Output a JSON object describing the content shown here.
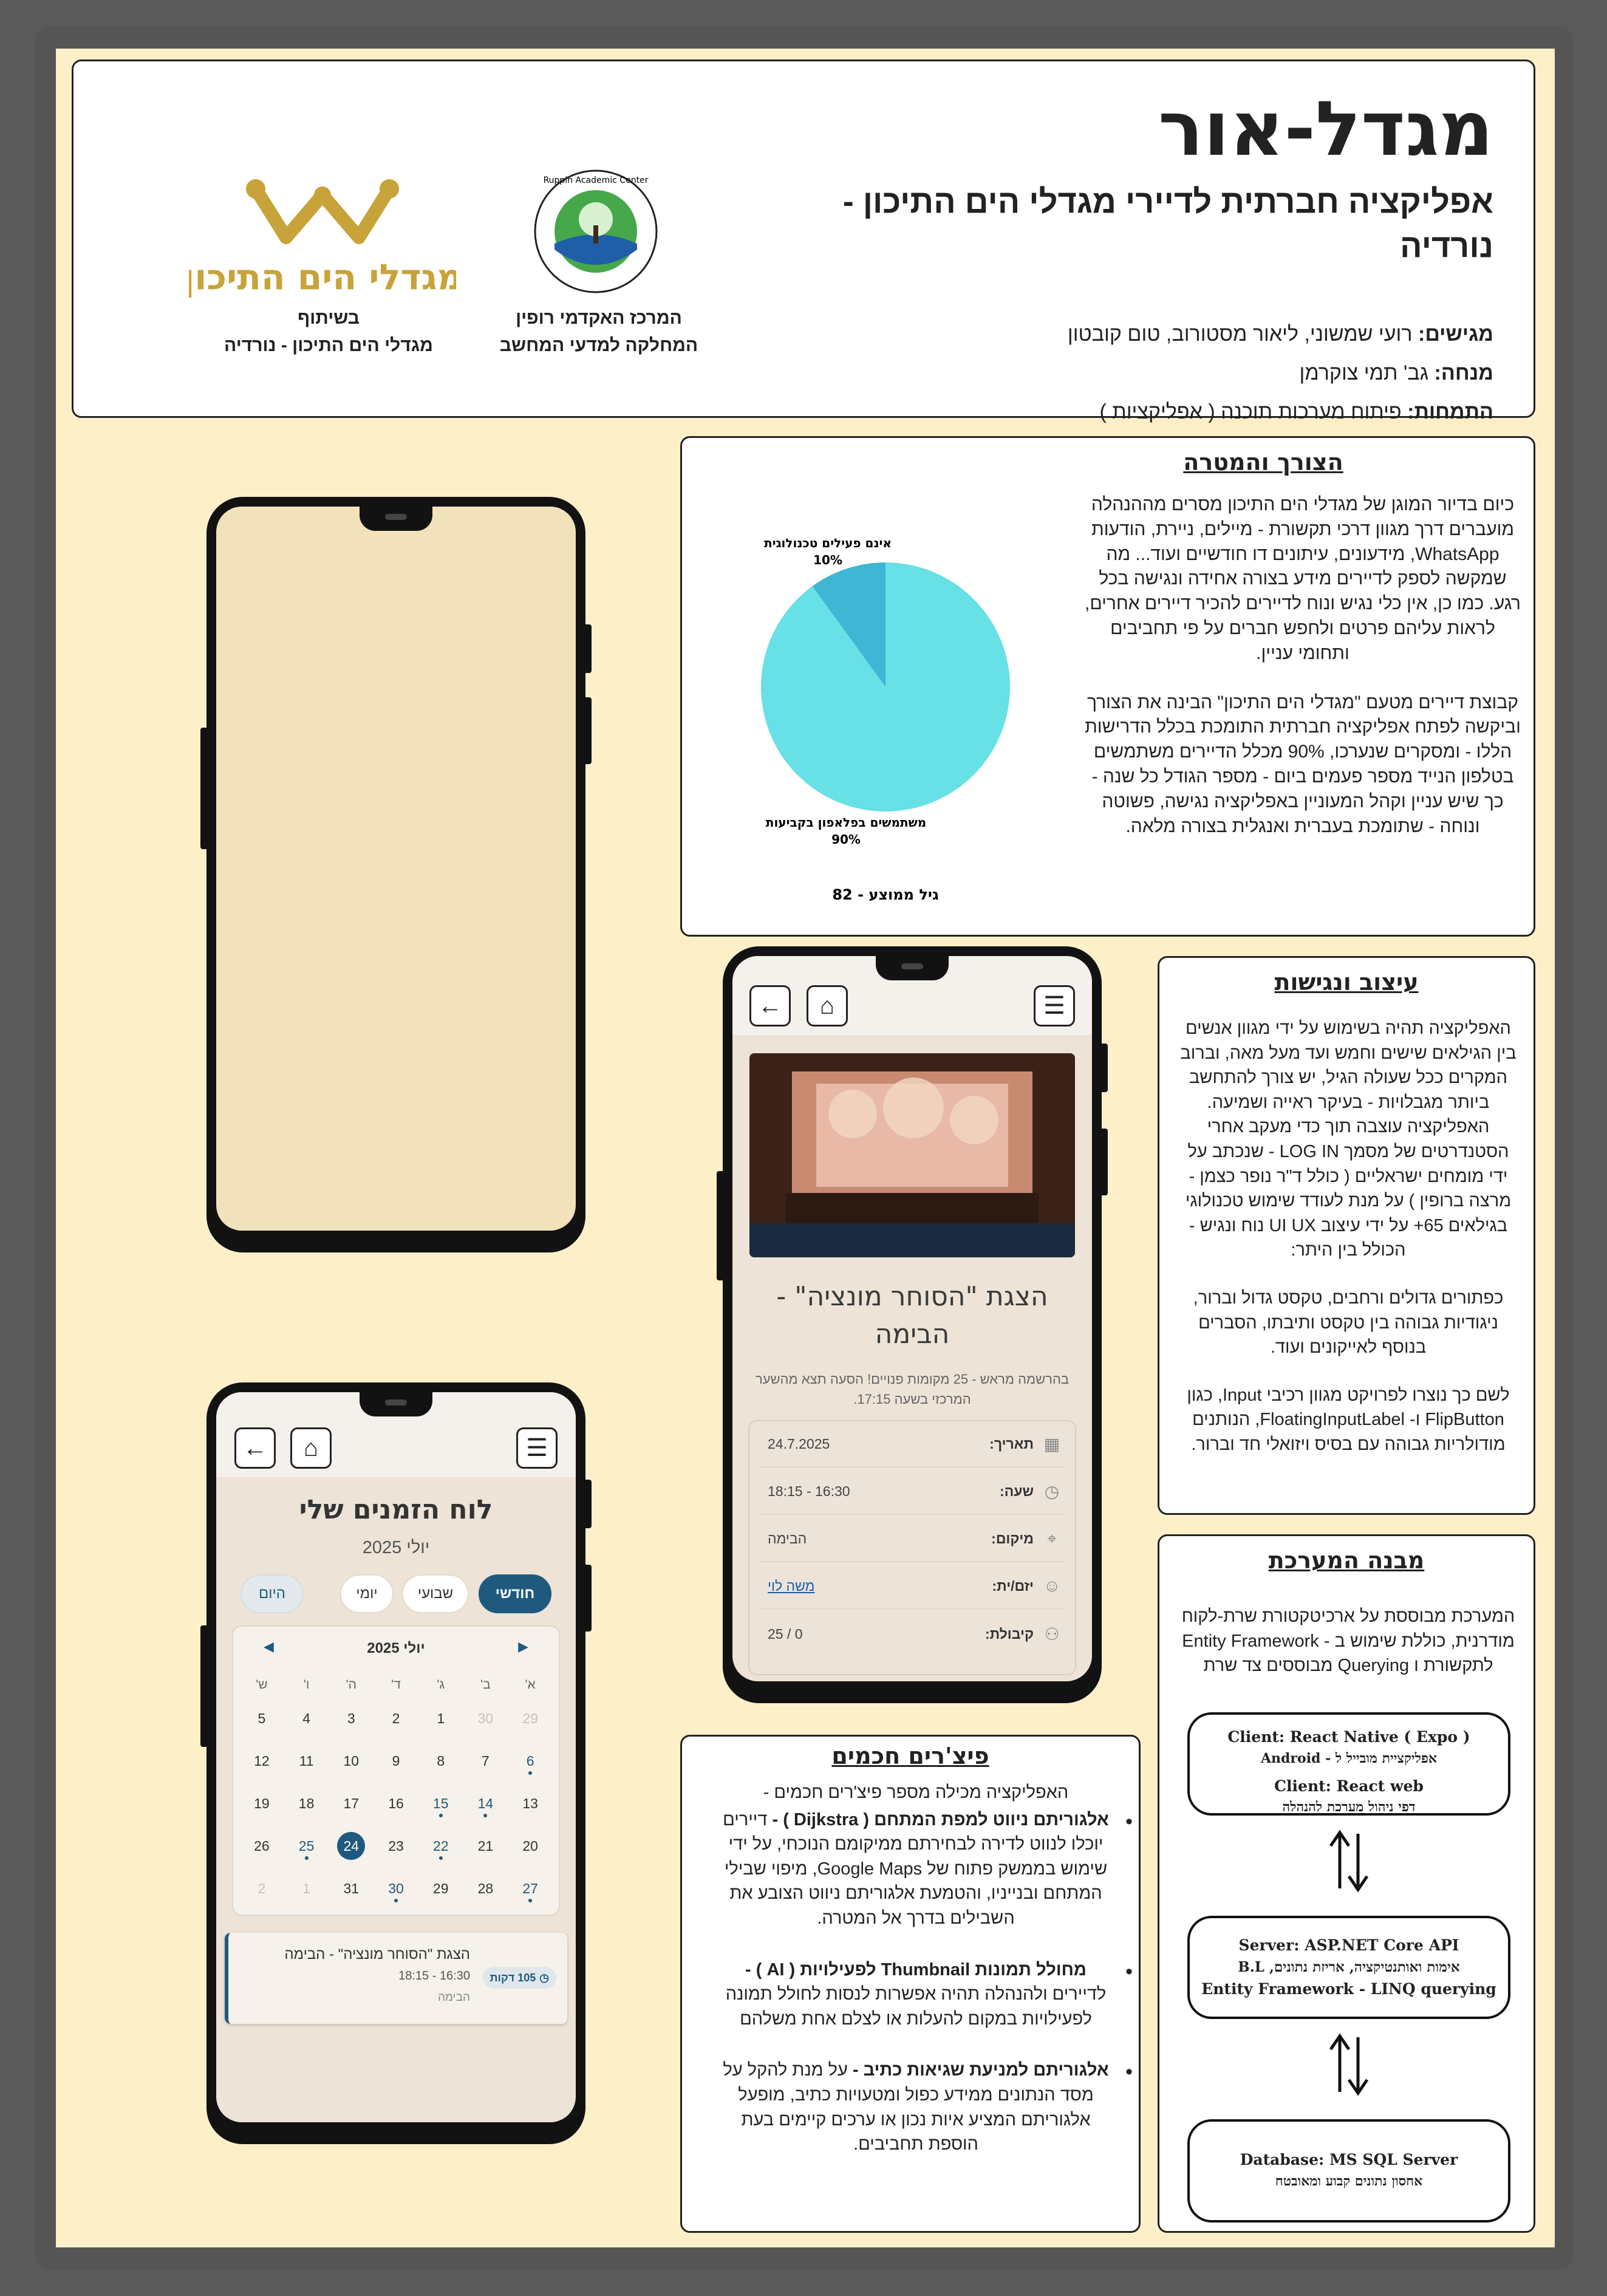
{
  "header": {
    "title": "מגדל-אור",
    "subtitle": "אפליקציה חברתית לדיירי מגדלי הים התיכון - נורדיה",
    "presenters_label": "מגישים:",
    "presenters": "רועי שמשוני, ליאור מסטורוב, טום קובטון",
    "mentor_label": "מנחה:",
    "mentor": "גב' תמי צוקרמן",
    "track_label": "התמחות:",
    "track": "פיתוח מערכות תוכנה ( אפליקציות )",
    "ruppin_caption_1": "המרכז האקדמי רופין",
    "ruppin_caption_2": "המחלקה למדעי המחשב",
    "partner_caption_1": "בשיתוף",
    "partner_caption_2": "מגדלי הים התיכון - נורדיה",
    "migdal_logo_text": "מגדלי הים התיכון"
  },
  "need": {
    "title": "הצורך והמטרה",
    "paragraph_1": "כיום בדיור המוגן של מגדלי הים התיכון מסרים מההנהלה מועברים דרך מגוון דרכי תקשורת - מיילים, ניירת, הודעות WhatsApp, מידעונים, עיתונים דו חודשיים ועוד... מה שמקשה לספק לדיירים מידע בצורה אחידה ונגישה בכל רגע. כמו כן, אין כלי נגיש ונוח לדיירים להכיר דיירים אחרים, לראות עליהם פרטים ולחפש חברים על פי תחביבים ותחומי עניין.",
    "paragraph_2": "קבוצת דיירים מטעם \"מגדלי הים התיכון\" הבינה את הצורך וביקשה לפתח אפליקציה חברתית התומכת בכלל הדרישות הללו - ומסקרים שנערכו, 90% מכלל הדיירים משתמשים בטלפון הנייד מספר פעמים ביום - מספר הגודל כל שנה - כך שיש עניין וקהל המעוניין באפליקציה נגישה, פשוטה ונוחה - שתומכת בעברית ואנגלית בצורה מלאה."
  },
  "chart_data": {
    "type": "pie",
    "slices": [
      {
        "label": "משתמשים בפלאפון בקביעות",
        "value": 90,
        "value_label": "90%",
        "color": "#67e0e6"
      },
      {
        "label": "אינם פעילים טכנולוגית",
        "value": 10,
        "value_label": "10%",
        "color": "#3fb6d4"
      }
    ],
    "footer": "גיל ממוצע - 82"
  },
  "design": {
    "title": "עיצוב ונגישות",
    "paragraph_1": "האפליקציה תהיה בשימוש על ידי מגוון אנשים בין הגילאים שישים וחמש ועד מעל מאה, וברוב המקרים ככל שעולה הגיל, יש צורך להתחשב ביותר מגבלויות - בעיקר ראייה ושמיעה. האפליקציה עוצבה תוך כדי מעקב אחרי הסטנדרטים של מסמך LOG IN - שנכתב על ידי מומחים ישראליים ( כולל ד\"ר נופר כצמן - מרצה ברופין ) על מנת לעודד שימוש טכנולוגי בגילאים 65+ על ידי עיצוב UI UX נוח ונגיש - הכולל בין היתר:",
    "paragraph_2": "כפתורים גדולים ורחבים, טקסט גדול וברור, ניגודיות גבוהה בין טקסט ותיבתו, הסברים בנוסף לאייקונים ועוד.",
    "paragraph_3": "לשם כך נוצרו לפרויקט מגוון רכיבי Input, כגון FlipButton ו- FloatingInputLabel, הנותנים מודולריות גבוהה עם בסיס ויזואלי חד וברור."
  },
  "architecture": {
    "title": "מבנה המערכת",
    "body": "המערכת מבוססת על ארכיטקטורת שרת-לקוח מודרנית, כוללת שימוש ב - Entity Framework לתקשורת ו Querying מבוססים צד שרת",
    "client_line_1": "Client: React Native ( Expo )",
    "client_line_2": "אפליקציית מובייל ל - Android",
    "client_line_3": "Client: React web",
    "client_line_4": "דפי ניהול מערכת להנהלה",
    "server_line_1": "Server: ASP.NET Core API",
    "server_line_2": "אימות ואותנטיקציה, אריזת נתונים, B.L",
    "server_line_3": "Entity Framework - LINQ querying",
    "db_line_1": "Database: MS SQL Server",
    "db_line_2": "אחסון נתונים קבוע ומאובטח"
  },
  "smart": {
    "title": "פיצ'רים חכמים",
    "intro": "האפליקציה מכילה מספר פיצ'רים חכמים -",
    "f1_title": "אלגוריתם ניווט למפת המתחם ( Dijkstra ) -",
    "f1_body": "דיירים יוכלו לנווט לדירה לבחירתם ממיקומם הנוכחי, על ידי שימוש בממשק פתוח של Google Maps, מיפוי שבילי המתחם ובנייניו, והטמעת אלגוריתם ניווט הצובע את השבילים בדרך אל המטרה.",
    "f2_title": "מחולל תמונות Thumbnail לפעילויות ( AI ) -",
    "f2_body": "לדיירים ולהנהלה תהיה אפשרות לנסות לחולל תמונה לפעילויות במקום להעלות או לצלם אחת משלהם",
    "f3_title": "אלגוריתם למניעת שגיאות כתיב -",
    "f3_body": "על מנת להקל על מסד הנתונים ממידע כפול ומטעויות כתיב, מופעל אלגוריתם המציע איות נכון או ערכים קיימים בעת הוספת תחביבים."
  },
  "phone_event": {
    "back_icon": "arrow-left-icon",
    "home_icon": "home-icon",
    "menu_icon": "menu-icon",
    "event_title": "הצגת \"הסוחר מונציה\" - הבימה",
    "event_desc": "בהרשמה מראש - 25 מקומות פנויים! הסעה תצא מהשער המרכזי בשעה 17:15.",
    "rows": [
      {
        "label": "תאריך:",
        "value": "24.7.2025",
        "icon": "calendar-icon"
      },
      {
        "label": "שעה:",
        "value": "16:30 - 18:15",
        "icon": "clock-icon"
      },
      {
        "label": "מיקום:",
        "value": "הבימה",
        "icon": "pin-icon"
      },
      {
        "label": "יזם/ית:",
        "value": "משה לוי",
        "icon": "user-icon"
      },
      {
        "label": "קיבולת:",
        "value": "0 / 25",
        "icon": "group-icon"
      }
    ]
  },
  "phone_calendar": {
    "title": "לוח הזמנים שלי",
    "month": "יולי 2025",
    "view_monthly": "חודשי",
    "view_weekly": "שבועי",
    "view_daily": "יומי",
    "view_today": "היום",
    "cal_header": "יולי 2025",
    "dow": [
      "א'",
      "ב'",
      "ג'",
      "ד'",
      "ה'",
      "ו'",
      "ש'"
    ],
    "weeks": [
      [
        "29",
        "30",
        "1",
        "2",
        "3",
        "4",
        "5"
      ],
      [
        "6",
        "7",
        "8",
        "9",
        "10",
        "11",
        "12"
      ],
      [
        "13",
        "14",
        "15",
        "16",
        "17",
        "18",
        "19"
      ],
      [
        "20",
        "21",
        "22",
        "23",
        "24",
        "25",
        "26"
      ],
      [
        "27",
        "28",
        "29",
        "30",
        "31",
        "1",
        "2"
      ]
    ],
    "card_title": "הצגת \"הסוחר מונציה\" - הבימה",
    "card_time": "16:30 - 18:15",
    "card_place": "הבימה",
    "card_badge": "105 דקות"
  }
}
